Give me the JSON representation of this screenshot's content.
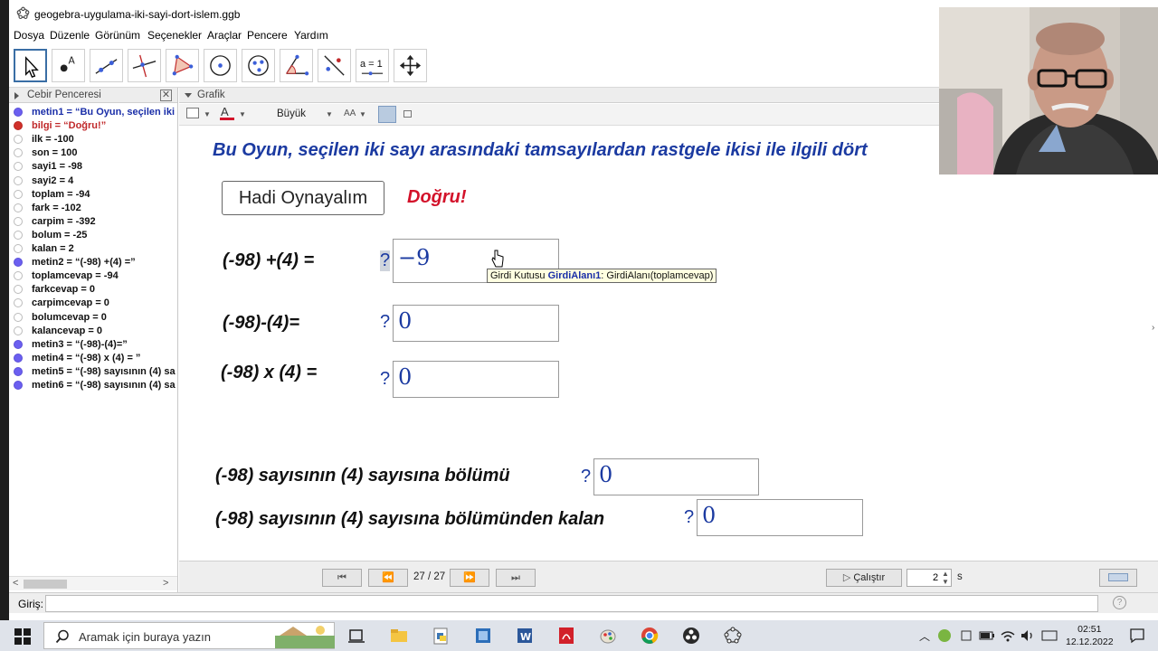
{
  "window": {
    "title": "geogebra-uygulama-iki-sayi-dort-islem.ggb"
  },
  "menu": [
    "Dosya",
    "Düzenle",
    "Görünüm",
    "Seçenekler",
    "Araçlar",
    "Pencere",
    "Yardım"
  ],
  "toolbar": {
    "slider_tool_label": "a = 1"
  },
  "algebra": {
    "title": "Cebir Penceresi",
    "close_glyph": "✕",
    "items": [
      {
        "text": "metin1 = “Bu Oyun, seçilen iki",
        "dot": "on",
        "color": "blue"
      },
      {
        "text": "bilgi = “Doğru!”",
        "dot": "red",
        "color": "red"
      },
      {
        "text": "ilk = -100",
        "dot": "off",
        "color": "black"
      },
      {
        "text": "son = 100",
        "dot": "off",
        "color": "black"
      },
      {
        "text": "sayi1 = -98",
        "dot": "off",
        "color": "black"
      },
      {
        "text": "sayi2 = 4",
        "dot": "off",
        "color": "black"
      },
      {
        "text": "toplam = -94",
        "dot": "off",
        "color": "black"
      },
      {
        "text": "fark = -102",
        "dot": "off",
        "color": "black"
      },
      {
        "text": "carpim = -392",
        "dot": "off",
        "color": "black"
      },
      {
        "text": "bolum = -25",
        "dot": "off",
        "color": "black"
      },
      {
        "text": "kalan = 2",
        "dot": "off",
        "color": "black"
      },
      {
        "text": "metin2 = “(-98) +(4) =”",
        "dot": "on",
        "color": "black"
      },
      {
        "text": "toplamcevap = -94",
        "dot": "off",
        "color": "black"
      },
      {
        "text": "farkcevap = 0",
        "dot": "off",
        "color": "black"
      },
      {
        "text": "carpimcevap = 0",
        "dot": "off",
        "color": "black"
      },
      {
        "text": "bolumcevap = 0",
        "dot": "off",
        "color": "black"
      },
      {
        "text": "kalancevap = 0",
        "dot": "off",
        "color": "black"
      },
      {
        "text": "metin3 = “(-98)-(4)=”",
        "dot": "on",
        "color": "black"
      },
      {
        "text": "metin4 = “(-98) x (4) = ”",
        "dot": "on",
        "color": "black"
      },
      {
        "text": "metin5 = “(-98) sayısının (4) sa",
        "dot": "on",
        "color": "black"
      },
      {
        "text": "metin6 = “(-98) sayısının (4) sa",
        "dot": "on",
        "color": "black"
      }
    ]
  },
  "graphics": {
    "title": "Grafik",
    "style": {
      "size_label": "Büyük",
      "font_label": "AA"
    },
    "headline": "Bu Oyun, seçilen iki sayı arasındaki tamsayılardan rastgele ikisi ile ilgili dört",
    "play_button": "Hadi Oynayalım",
    "feedback": "Doğru!",
    "questions": [
      {
        "label": "(-98) +(4) =",
        "mark": "?",
        "value": "−9"
      },
      {
        "label": "(-98)-(4)=",
        "mark": "?",
        "value": "0"
      },
      {
        "label": "(-98) x (4) =",
        "mark": "?",
        "value": "0"
      },
      {
        "label": "(-98) sayısının (4) sayısına bölümü",
        "mark": "?",
        "value": "0"
      },
      {
        "label": "(-98) sayısının (4) sayısına bölümünden kalan",
        "mark": "?",
        "value": "0"
      }
    ],
    "tooltip": {
      "prefix": "Girdi Kutusu ",
      "name": "GirdiAlanı1",
      "suffix": ": GirdiAlanı(toplamcevap)"
    }
  },
  "player": {
    "first": "⏮",
    "prev": "⏪",
    "counter": "27 / 27",
    "next": "⏩",
    "last": "⏭",
    "run_label": "Çalıştır",
    "delay_value": "2",
    "delay_unit": "s"
  },
  "inputbar": {
    "label": "Giriş:",
    "help": "?"
  },
  "taskbar": {
    "search_placeholder": "Aramak için buraya yazın",
    "time": "02:51",
    "date": "12.12.2022"
  },
  "colors": {
    "accent_blue": "#1b3aa1",
    "feedback_red": "#d3122a",
    "visible_dot": "#6b5ff0"
  }
}
